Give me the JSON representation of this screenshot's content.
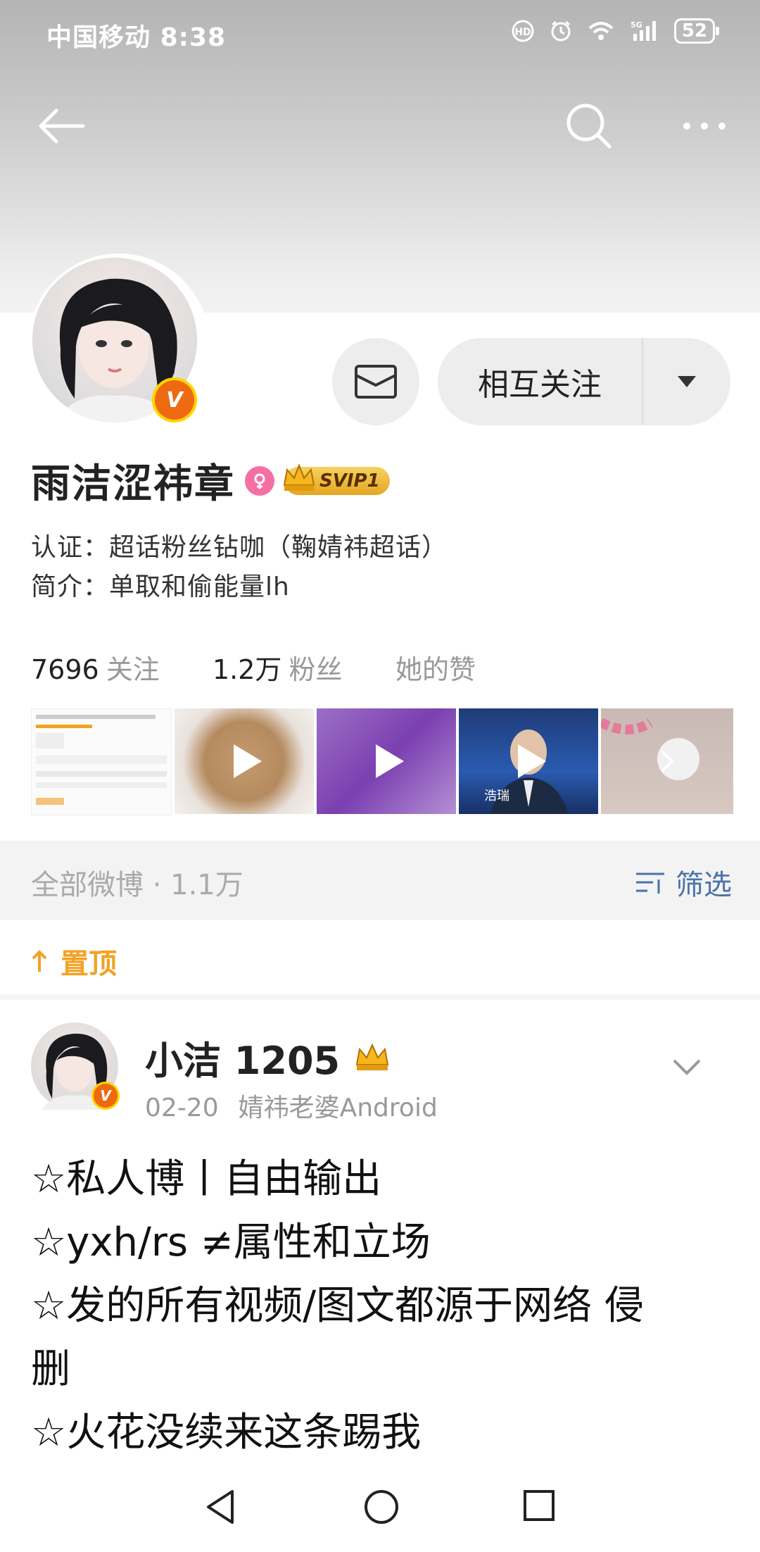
{
  "status_bar": {
    "carrier": "中国移动",
    "time": "8:38",
    "signal_label": "5G",
    "battery": "52"
  },
  "profile": {
    "name": "雨洁涩祎章",
    "svip_label": "SVIP1",
    "verification_label": "认证：",
    "verification_value": "超话粉丝钻咖（鞠婧祎超话）",
    "bio_label": "简介：",
    "bio_value": "单取和偷能量lh",
    "avatar_badge": "V",
    "message_button": "message",
    "follow_button": "相互关注"
  },
  "stats": [
    {
      "number": "7696",
      "label": "关注"
    },
    {
      "number": "1.2万",
      "label": "粉丝"
    },
    {
      "number": "",
      "label": "她的赞"
    }
  ],
  "media_strip": [
    {
      "kind": "image",
      "title": "",
      "has_play": false
    },
    {
      "kind": "video",
      "title": "",
      "has_play": true
    },
    {
      "kind": "video",
      "title": "",
      "has_play": true
    },
    {
      "kind": "video",
      "caption": "浩瑞",
      "has_play": true
    },
    {
      "kind": "more",
      "title": "",
      "has_play": false
    }
  ],
  "posts_section": {
    "title": "全部微博 · 1.1万",
    "filter_label": "筛选"
  },
  "pinned_label": "置顶",
  "post": {
    "user": "小洁 1205",
    "date": "02-20",
    "source": "婧祎老婆Android",
    "avatar_badge": "V",
    "lines": [
      "☆私人博丨自由输出",
      "☆yxh/rs ≠属性和立场",
      "☆发的所有视频/图文都源于网络 侵",
      "删",
      "☆火花没续来这条踢我"
    ]
  }
}
